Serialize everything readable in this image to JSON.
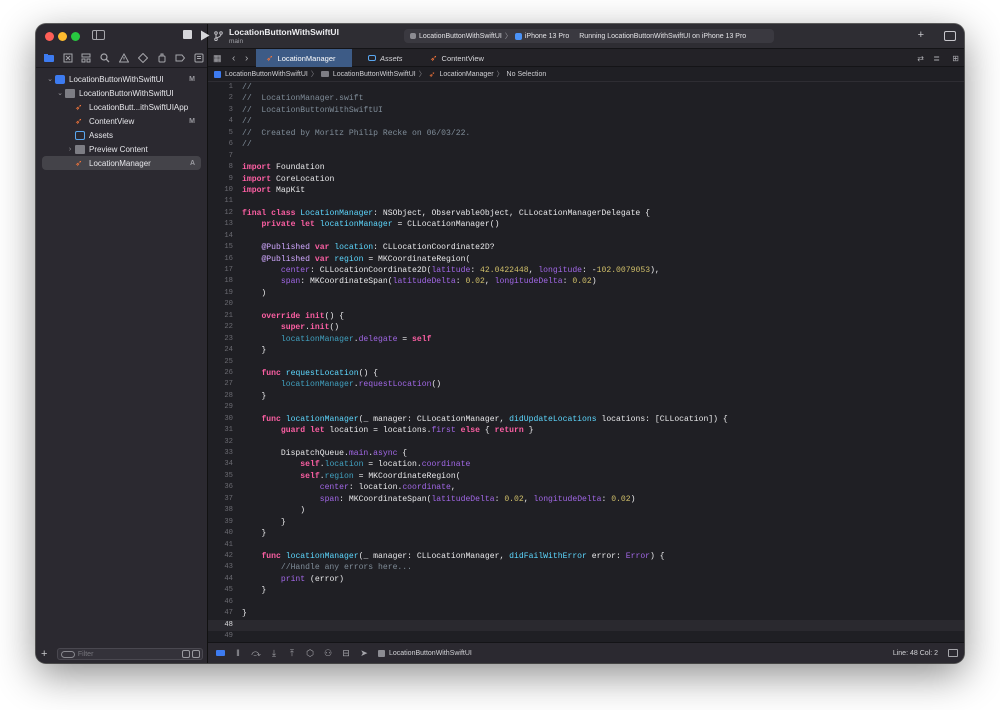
{
  "window": {
    "traffic_colors": [
      "#ff5f57",
      "#febc2e",
      "#28c840"
    ]
  },
  "navigator": {
    "tree": [
      {
        "label": "LocationButtonWithSwiftUI",
        "badge": "M",
        "icon": "project-icon",
        "level": 0,
        "chevron": "v"
      },
      {
        "label": "LocationButtonWithSwiftUI",
        "badge": "",
        "icon": "folder-icon",
        "level": 1,
        "chevron": "v"
      },
      {
        "label": "LocationButt...ithSwiftUIApp",
        "badge": "",
        "icon": "swift-file-icon",
        "level": 2,
        "chevron": ""
      },
      {
        "label": "ContentView",
        "badge": "M",
        "icon": "swift-file-icon",
        "level": 2,
        "chevron": ""
      },
      {
        "label": "Assets",
        "badge": "",
        "icon": "assets-icon",
        "level": 2,
        "chevron": ""
      },
      {
        "label": "Preview Content",
        "badge": "",
        "icon": "folder-icon",
        "level": 2,
        "chevron": ">"
      },
      {
        "label": "LocationManager",
        "badge": "A",
        "icon": "swift-file-icon",
        "level": 2,
        "chevron": "",
        "selected": true
      }
    ],
    "filter_placeholder": "Filter"
  },
  "toolbar": {
    "project_title": "LocationButtonWithSwiftUI",
    "branch": "main",
    "scheme_target": "LocationButtonWithSwiftUI",
    "device": "iPhone 13 Pro",
    "status": "Running LocationButtonWithSwiftUI on iPhone 13 Pro"
  },
  "tabs": [
    {
      "label": "LocationManager",
      "active": true,
      "icon": "swift-file-icon"
    },
    {
      "label": "Assets",
      "active": false,
      "icon": "assets-icon"
    },
    {
      "label": "ContentView",
      "active": false,
      "icon": "swift-file-icon"
    }
  ],
  "jumpbar": [
    "LocationButtonWithSwiftUI",
    "LocationButtonWithSwiftUI",
    "LocationManager",
    "No Selection"
  ],
  "editor": {
    "current_line": 48,
    "lines": [
      [
        [
          "c",
          "//"
        ]
      ],
      [
        [
          "c",
          "//  LocationManager.swift"
        ]
      ],
      [
        [
          "c",
          "//  LocationButtonWithSwiftUI"
        ]
      ],
      [
        [
          "c",
          "//"
        ]
      ],
      [
        [
          "c",
          "//  Created by Moritz Philip Recke on 06/03/22."
        ]
      ],
      [
        [
          "c",
          "//"
        ]
      ],
      [],
      [
        [
          "k",
          "import"
        ],
        [
          "p",
          " Foundation"
        ]
      ],
      [
        [
          "k",
          "import"
        ],
        [
          "p",
          " CoreLocation"
        ]
      ],
      [
        [
          "k",
          "import"
        ],
        [
          "p",
          " MapKit"
        ]
      ],
      [],
      [
        [
          "k",
          "final class"
        ],
        [
          "p",
          " "
        ],
        [
          "tn",
          "LocationManager"
        ],
        [
          "p",
          ": NSObject, ObservableObject, CLLocationManagerDelegate {"
        ]
      ],
      [
        [
          "p",
          "    "
        ],
        [
          "k",
          "private let"
        ],
        [
          "p",
          " "
        ],
        [
          "tn",
          "locationManager"
        ],
        [
          "p",
          " = CLLocationManager()"
        ]
      ],
      [],
      [
        [
          "p",
          "    "
        ],
        [
          "t",
          "@Published"
        ],
        [
          "p",
          " "
        ],
        [
          "k",
          "var"
        ],
        [
          "p",
          " "
        ],
        [
          "tn",
          "location"
        ],
        [
          "p",
          ": CLLocationCoordinate2D?"
        ]
      ],
      [
        [
          "p",
          "    "
        ],
        [
          "t",
          "@Published"
        ],
        [
          "p",
          " "
        ],
        [
          "k",
          "var"
        ],
        [
          "p",
          " "
        ],
        [
          "tn",
          "region"
        ],
        [
          "p",
          " = MKCoordinateRegion("
        ]
      ],
      [
        [
          "p",
          "        "
        ],
        [
          "ti2",
          "center"
        ],
        [
          "p",
          ": CLLocationCoordinate2D("
        ],
        [
          "ti2",
          "latitude"
        ],
        [
          "p",
          ": "
        ],
        [
          "n",
          "42.0422448"
        ],
        [
          "p",
          ", "
        ],
        [
          "ti2",
          "longitude"
        ],
        [
          "p",
          ": -"
        ],
        [
          "n",
          "102.0079053"
        ],
        [
          "p",
          "),"
        ]
      ],
      [
        [
          "p",
          "        "
        ],
        [
          "ti2",
          "span"
        ],
        [
          "p",
          ": MKCoordinateSpan("
        ],
        [
          "ti2",
          "latitudeDelta"
        ],
        [
          "p",
          ": "
        ],
        [
          "n",
          "0.02"
        ],
        [
          "p",
          ", "
        ],
        [
          "ti2",
          "longitudeDelta"
        ],
        [
          "p",
          ": "
        ],
        [
          "n",
          "0.02"
        ],
        [
          "p",
          ")"
        ]
      ],
      [
        [
          "p",
          "    )"
        ]
      ],
      [],
      [
        [
          "p",
          "    "
        ],
        [
          "k",
          "override"
        ],
        [
          "p",
          " "
        ],
        [
          "k",
          "init"
        ],
        [
          "p",
          "() {"
        ]
      ],
      [
        [
          "p",
          "        "
        ],
        [
          "k",
          "super"
        ],
        [
          "p",
          "."
        ],
        [
          "k",
          "init"
        ],
        [
          "p",
          "()"
        ]
      ],
      [
        [
          "p",
          "        "
        ],
        [
          "fd",
          "locationManager"
        ],
        [
          "p",
          "."
        ],
        [
          "ti2",
          "delegate"
        ],
        [
          "p",
          " = "
        ],
        [
          "k",
          "self"
        ]
      ],
      [
        [
          "p",
          "    }"
        ]
      ],
      [],
      [
        [
          "p",
          "    "
        ],
        [
          "k",
          "func"
        ],
        [
          "p",
          " "
        ],
        [
          "tn",
          "requestLocation"
        ],
        [
          "p",
          "() {"
        ]
      ],
      [
        [
          "p",
          "        "
        ],
        [
          "fd",
          "locationManager"
        ],
        [
          "p",
          "."
        ],
        [
          "ti2",
          "requestLocation"
        ],
        [
          "p",
          "()"
        ]
      ],
      [
        [
          "p",
          "    }"
        ]
      ],
      [],
      [
        [
          "p",
          "    "
        ],
        [
          "k",
          "func"
        ],
        [
          "p",
          " "
        ],
        [
          "tn",
          "locationManager"
        ],
        [
          "p",
          "(_ manager: CLLocationManager, "
        ],
        [
          "tn",
          "didUpdateLocations"
        ],
        [
          "p",
          " locations: [CLLocation]) {"
        ]
      ],
      [
        [
          "p",
          "        "
        ],
        [
          "k",
          "guard let"
        ],
        [
          "p",
          " location = locations."
        ],
        [
          "ti2",
          "first"
        ],
        [
          "p",
          " "
        ],
        [
          "k",
          "else"
        ],
        [
          "p",
          " { "
        ],
        [
          "k",
          "return"
        ],
        [
          "p",
          " }"
        ]
      ],
      [],
      [
        [
          "p",
          "        DispatchQueue."
        ],
        [
          "ti2",
          "main"
        ],
        [
          "p",
          "."
        ],
        [
          "ti2",
          "async"
        ],
        [
          "p",
          " {"
        ]
      ],
      [
        [
          "p",
          "            "
        ],
        [
          "k",
          "self"
        ],
        [
          "p",
          "."
        ],
        [
          "fd",
          "location"
        ],
        [
          "p",
          " = location."
        ],
        [
          "ti2",
          "coordinate"
        ]
      ],
      [
        [
          "p",
          "            "
        ],
        [
          "k",
          "self"
        ],
        [
          "p",
          "."
        ],
        [
          "fd",
          "region"
        ],
        [
          "p",
          " = MKCoordinateRegion("
        ]
      ],
      [
        [
          "p",
          "                "
        ],
        [
          "ti2",
          "center"
        ],
        [
          "p",
          ": location."
        ],
        [
          "ti2",
          "coordinate"
        ],
        [
          "p",
          ","
        ]
      ],
      [
        [
          "p",
          "                "
        ],
        [
          "ti2",
          "span"
        ],
        [
          "p",
          ": MKCoordinateSpan("
        ],
        [
          "ti2",
          "latitudeDelta"
        ],
        [
          "p",
          ": "
        ],
        [
          "n",
          "0.02"
        ],
        [
          "p",
          ", "
        ],
        [
          "ti2",
          "longitudeDelta"
        ],
        [
          "p",
          ": "
        ],
        [
          "n",
          "0.02"
        ],
        [
          "p",
          ")"
        ]
      ],
      [
        [
          "p",
          "            )"
        ]
      ],
      [
        [
          "p",
          "        }"
        ]
      ],
      [
        [
          "p",
          "    }"
        ]
      ],
      [],
      [
        [
          "p",
          "    "
        ],
        [
          "k",
          "func"
        ],
        [
          "p",
          " "
        ],
        [
          "tn",
          "locationManager"
        ],
        [
          "p",
          "(_ manager: CLLocationManager, "
        ],
        [
          "tn",
          "didFailWithError"
        ],
        [
          "p",
          " error: "
        ],
        [
          "ti2",
          "Error"
        ],
        [
          "p",
          ") {"
        ]
      ],
      [
        [
          "p",
          "        "
        ],
        [
          "c",
          "//Handle any errors here..."
        ]
      ],
      [
        [
          "p",
          "        "
        ],
        [
          "ti2",
          "print"
        ],
        [
          "p",
          " (error)"
        ]
      ],
      [
        [
          "p",
          "    }"
        ]
      ],
      [],
      [
        [
          "p",
          "}"
        ]
      ],
      [],
      []
    ]
  },
  "statusbar": {
    "scheme": "LocationButtonWithSwiftUI",
    "cursor": "Line: 48  Col: 2"
  }
}
